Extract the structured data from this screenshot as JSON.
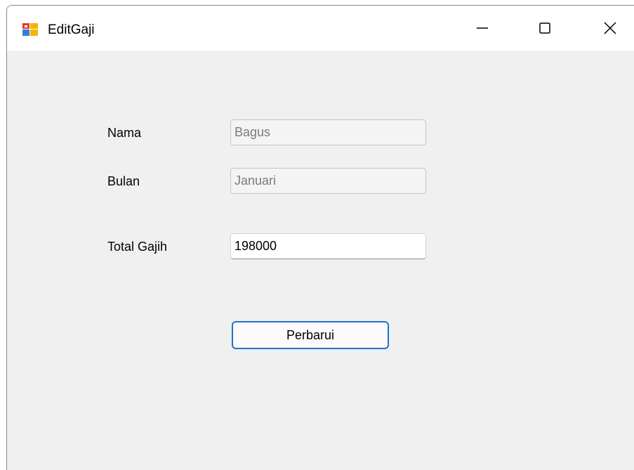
{
  "window": {
    "title": "EditGaji",
    "controls": {
      "minimize_icon": "minimize-icon",
      "maximize_icon": "maximize-icon",
      "close_icon": "close-icon"
    }
  },
  "form": {
    "nama_label": "Nama",
    "nama_value": "Bagus",
    "bulan_label": "Bulan",
    "bulan_value": "Januari",
    "total_label": "Total Gajih",
    "total_value": "198000",
    "submit_label": "Perbarui"
  },
  "colors": {
    "window_bg": "#f0f0f0",
    "titlebar_bg": "#ffffff",
    "button_border": "#1f73c8",
    "disabled_text": "#7a7a7a"
  }
}
